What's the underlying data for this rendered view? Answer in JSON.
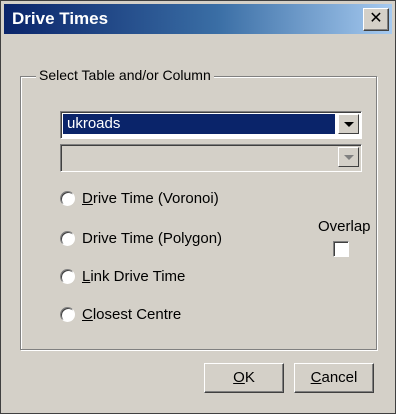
{
  "window": {
    "title": "Drive Times",
    "close_glyph": "✕"
  },
  "group": {
    "label": "Select Table and/or Column"
  },
  "table_combo": {
    "value": "ukroads"
  },
  "column_combo": {
    "value": ""
  },
  "options": [
    {
      "accel": "D",
      "rest": "rive Time (Voronoi)"
    },
    {
      "accel": "",
      "rest": "Drive Time (Polygon)"
    },
    {
      "accel": "L",
      "rest": "ink Drive Time"
    },
    {
      "accel": "C",
      "rest": "losest Centre"
    }
  ],
  "overlap": {
    "label": "Overlap",
    "checked": false
  },
  "buttons": {
    "ok": {
      "accel": "O",
      "rest": "K"
    },
    "cancel": {
      "accel": "C",
      "rest": "ancel"
    }
  },
  "colors": {
    "title_start": "#0a246a",
    "title_end": "#a6caf0",
    "face": "#d4d0c8",
    "selection": "#0a246a"
  }
}
